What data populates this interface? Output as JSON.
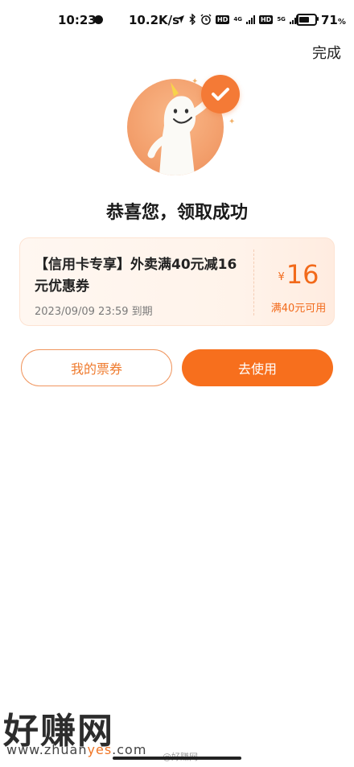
{
  "status_bar": {
    "time": "10:23",
    "speed": "10.2K/s",
    "network_badges": [
      "HD",
      "4G",
      "HD",
      "5G"
    ],
    "battery_pct": "71",
    "battery_unit": "%"
  },
  "header": {
    "done_label": "完成"
  },
  "success_title": "恭喜您，领取成功",
  "coupon": {
    "title": "【信用卡专享】外卖满40元减16元优惠券",
    "expiry": "2023/09/09 23:59 到期",
    "currency": "¥",
    "amount": "16",
    "condition": "满40元可用"
  },
  "buttons": {
    "my_tickets": "我的票券",
    "use_now": "去使用"
  },
  "watermark": {
    "logo": "好赚网",
    "url_prefix": "www.zhuan",
    "url_accent": "yes",
    "url_suffix": ".com",
    "weibo": "@好赚网"
  },
  "colors": {
    "accent": "#f76f1d",
    "amount": "#f26a1b"
  }
}
